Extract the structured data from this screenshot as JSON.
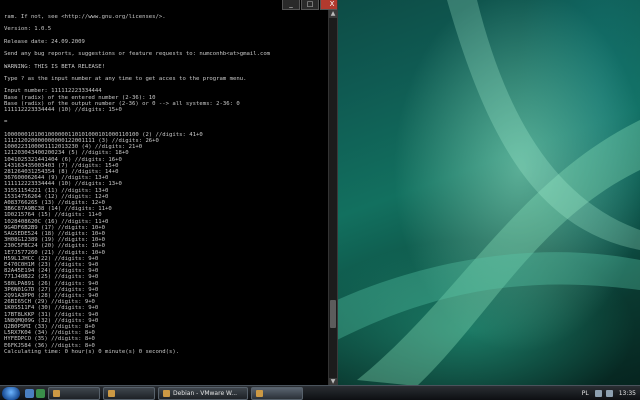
{
  "console": {
    "lines": [
      "ram. If not, see <http://www.gnu.org/licenses/>.",
      "",
      "Version: 1.0.5",
      "",
      "Release date: 24.09.2009",
      "",
      "Send any bug reports, suggestions or feature requests to: numconhb<at>gmail.com",
      "",
      "WARNING: THIS IS BETA RELEASE!",
      "",
      "Type ? as the input number at any time to get acces to the program menu.",
      "",
      "Input number: 111112223334444",
      "Base (radix) of the entered number (2-36): 10",
      "Base (radix) of the output number (2-36) or 0 --> all systems: 2-36: 0",
      "111112223334444 (10) //digits: 15+0",
      "",
      "=",
      "",
      "1000000101001000000110101000101000110100 (2) //digits: 41+0",
      "111212020000000000122001111 (3) //digits: 26+0",
      "1000223100001112013230 (4) //digits: 21+0",
      "121203043400200234 (5) //digits: 18+0",
      "1041025321441404 (6) //digits: 16+0",
      "143163435003403 (7) //digits: 15+0",
      "281264031254354 (8) //digits: 14+0",
      "367600062644 (9) //digits: 13+0",
      "111112223334444 (10) //digits: 13+0",
      "31551154221 (11) //digits: 13+0",
      "15314756264 (12) //digits: 12+0",
      "A083766265 (13) //digits: 12+0",
      "3B6C87A9BC38 (14) //digits: 11+0",
      "1D0215764 (15) //digits: 11+0",
      "1028408620C (16) //digits: 11+0",
      "9G4DF6B2B9 (17) //digits: 10+0",
      "5AG5EDE524 (18) //digits: 10+0",
      "3H08G12389 (19) //digits: 10+0",
      "230C5FBC24 (20) //digits: 10+0",
      "1E7J577260 (21) //digits: 10+0",
      "H59L1JHCC (22) //digits: 9+0",
      "E470C0H1M (23) //digits: 9+0",
      "82A45E194 (24) //digits: 9+0",
      "771J40B22 (25) //digits: 9+0",
      "580LPA891 (26) //digits: 9+0",
      "3P6N01G7D (27) //digits: 9+0",
      "2Q91A3PP0 (28) //digits: 9+0",
      "26BI65CH (29) //digits: 9+0",
      "1K0S511F4 (30) //digits: 9+0",
      "17BT8LKKP (31) //digits: 9+0",
      "1N8QMQ09G (32) //digits: 9+0",
      "Q2B0P5MI (33) //digits: 8+0",
      "L5RX7K04 (34) //digits: 8+0",
      "HYFEDPCO (35) //digits: 8+0",
      "E6FKJ584 (36) //digits: 8+0",
      "Calculating time: 0 hour(s) 0 minute(s) 0 second(s)."
    ]
  },
  "window_controls": {
    "minimize": "_",
    "maximize": "□",
    "close": "X"
  },
  "taskbar": {
    "tasks": [
      {
        "label": "",
        "active": false
      },
      {
        "label": "",
        "active": false
      },
      {
        "label": "Debian - VMware W...",
        "active": false
      },
      {
        "label": "",
        "active": true
      }
    ],
    "tray": {
      "language": "PL",
      "clock": "13:35"
    }
  },
  "colors": {
    "console_bg": "#000000",
    "console_text": "#c9c9c9",
    "close_button": "#b23a2e",
    "taskbar": "#1a1e22"
  }
}
